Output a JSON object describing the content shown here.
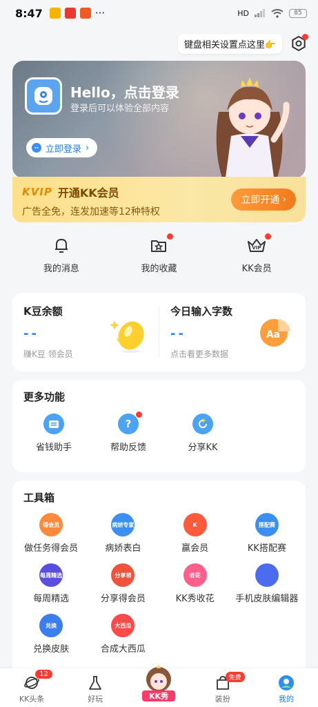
{
  "status": {
    "time": "8:47",
    "dots": "···",
    "network": "HD",
    "battery": "85"
  },
  "hint": {
    "text": "键盘相关设置点这里👉"
  },
  "hero": {
    "title": "Hello，点击登录",
    "subtitle": "登录后可以体验全部内容",
    "login_label": "立即登录",
    "login_arrow": "›"
  },
  "vip": {
    "logo": "KVIP",
    "title": "开通KK会员",
    "desc": "广告全免，连发加速等12种特权",
    "button": "立即开通",
    "button_arrow": "›"
  },
  "quick": [
    {
      "label": "我的消息"
    },
    {
      "label": "我的收藏"
    },
    {
      "label": "KK会员",
      "icon_text": "VIP"
    }
  ],
  "stats": {
    "left": {
      "label": "K豆余额",
      "value": "--",
      "foot": "赚K豆 领会员"
    },
    "right": {
      "label": "今日输入字数",
      "value": "--",
      "foot": "点击看更多数据",
      "icon_text": "Aa"
    }
  },
  "more": {
    "title": "更多功能",
    "items": [
      {
        "label": "省钱助手"
      },
      {
        "label": "帮助反馈",
        "icon_text": "?"
      },
      {
        "label": "分享KK"
      }
    ]
  },
  "tools": {
    "title": "工具箱",
    "items": [
      {
        "label": "做任务得会员",
        "color": "#ff8a3d",
        "tag": "得会员"
      },
      {
        "label": "病娇表白",
        "color": "#3a8ff0",
        "tag": "病娇专家"
      },
      {
        "label": "赢会员",
        "color": "#ff5a3c",
        "tag": "K"
      },
      {
        "label": "KK搭配赛",
        "color": "#3a8ff0",
        "tag": "搭配赛"
      },
      {
        "label": "每周精选",
        "color": "#5a4ee0",
        "tag": "每周精选"
      },
      {
        "label": "分享得会员",
        "color": "#f0533c",
        "tag": "分享领"
      },
      {
        "label": "KK秀收花",
        "color": "#ff5f8a",
        "tag": "收花"
      },
      {
        "label": "手机皮肤编辑器",
        "color": "#4c6cf0",
        "tag": ""
      },
      {
        "label": "兑换皮肤",
        "color": "#3a7ef0",
        "tag": "兑换"
      },
      {
        "label": "合成大西瓜",
        "color": "#ff4a4a",
        "tag": "大西瓜"
      }
    ]
  },
  "nav": [
    {
      "label": "KK头条",
      "badge": "12"
    },
    {
      "label": "好玩"
    },
    {
      "label": "KK秀"
    },
    {
      "label": "装扮",
      "badge": "免费"
    },
    {
      "label": "我的"
    }
  ]
}
